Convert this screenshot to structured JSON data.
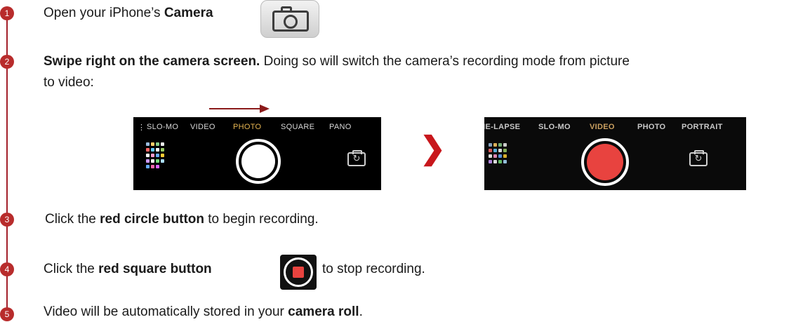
{
  "colors": {
    "accent": "#b82c2c",
    "timeline": "#a3202a",
    "record_red": "#e8433f",
    "active_mode": "#e6b552"
  },
  "steps": [
    {
      "num": "1",
      "pre": "Open your iPhone’s ",
      "bold": "Camera",
      "post": ""
    },
    {
      "num": "2",
      "bold": "Swipe right on the camera screen.",
      "line1": " Doing so will switch the camera’s recording mode from picture",
      "line2": "to video:"
    },
    {
      "num": "3",
      "pre": "Click the ",
      "bold": "red circle button",
      "post": " to begin recording."
    },
    {
      "num": "4",
      "pre": "Click the ",
      "bold": "red square button",
      "post": " to stop recording."
    },
    {
      "num": "5",
      "pre": "Video will be automatically stored in your ",
      "bold": "camera roll",
      "post": "."
    }
  ],
  "screen_before": {
    "modes": [
      "SLO-MO",
      "VIDEO",
      "PHOTO",
      "SQUARE",
      "PANO"
    ],
    "active": "PHOTO"
  },
  "screen_after": {
    "modes": [
      "ME-LAPSE",
      "SLO-MO",
      "VIDEO",
      "PHOTO",
      "PORTRAIT"
    ],
    "active": "VIDEO"
  },
  "icons": {
    "camera_app": "camera-icon",
    "swipe_arrow": "arrow-right-icon",
    "transition": "chevron-right-icon",
    "stop_button": "stop-record-icon",
    "flip_camera": "flip-camera-icon"
  },
  "chevron_glyph": "❯",
  "flip_glyph": "↻"
}
